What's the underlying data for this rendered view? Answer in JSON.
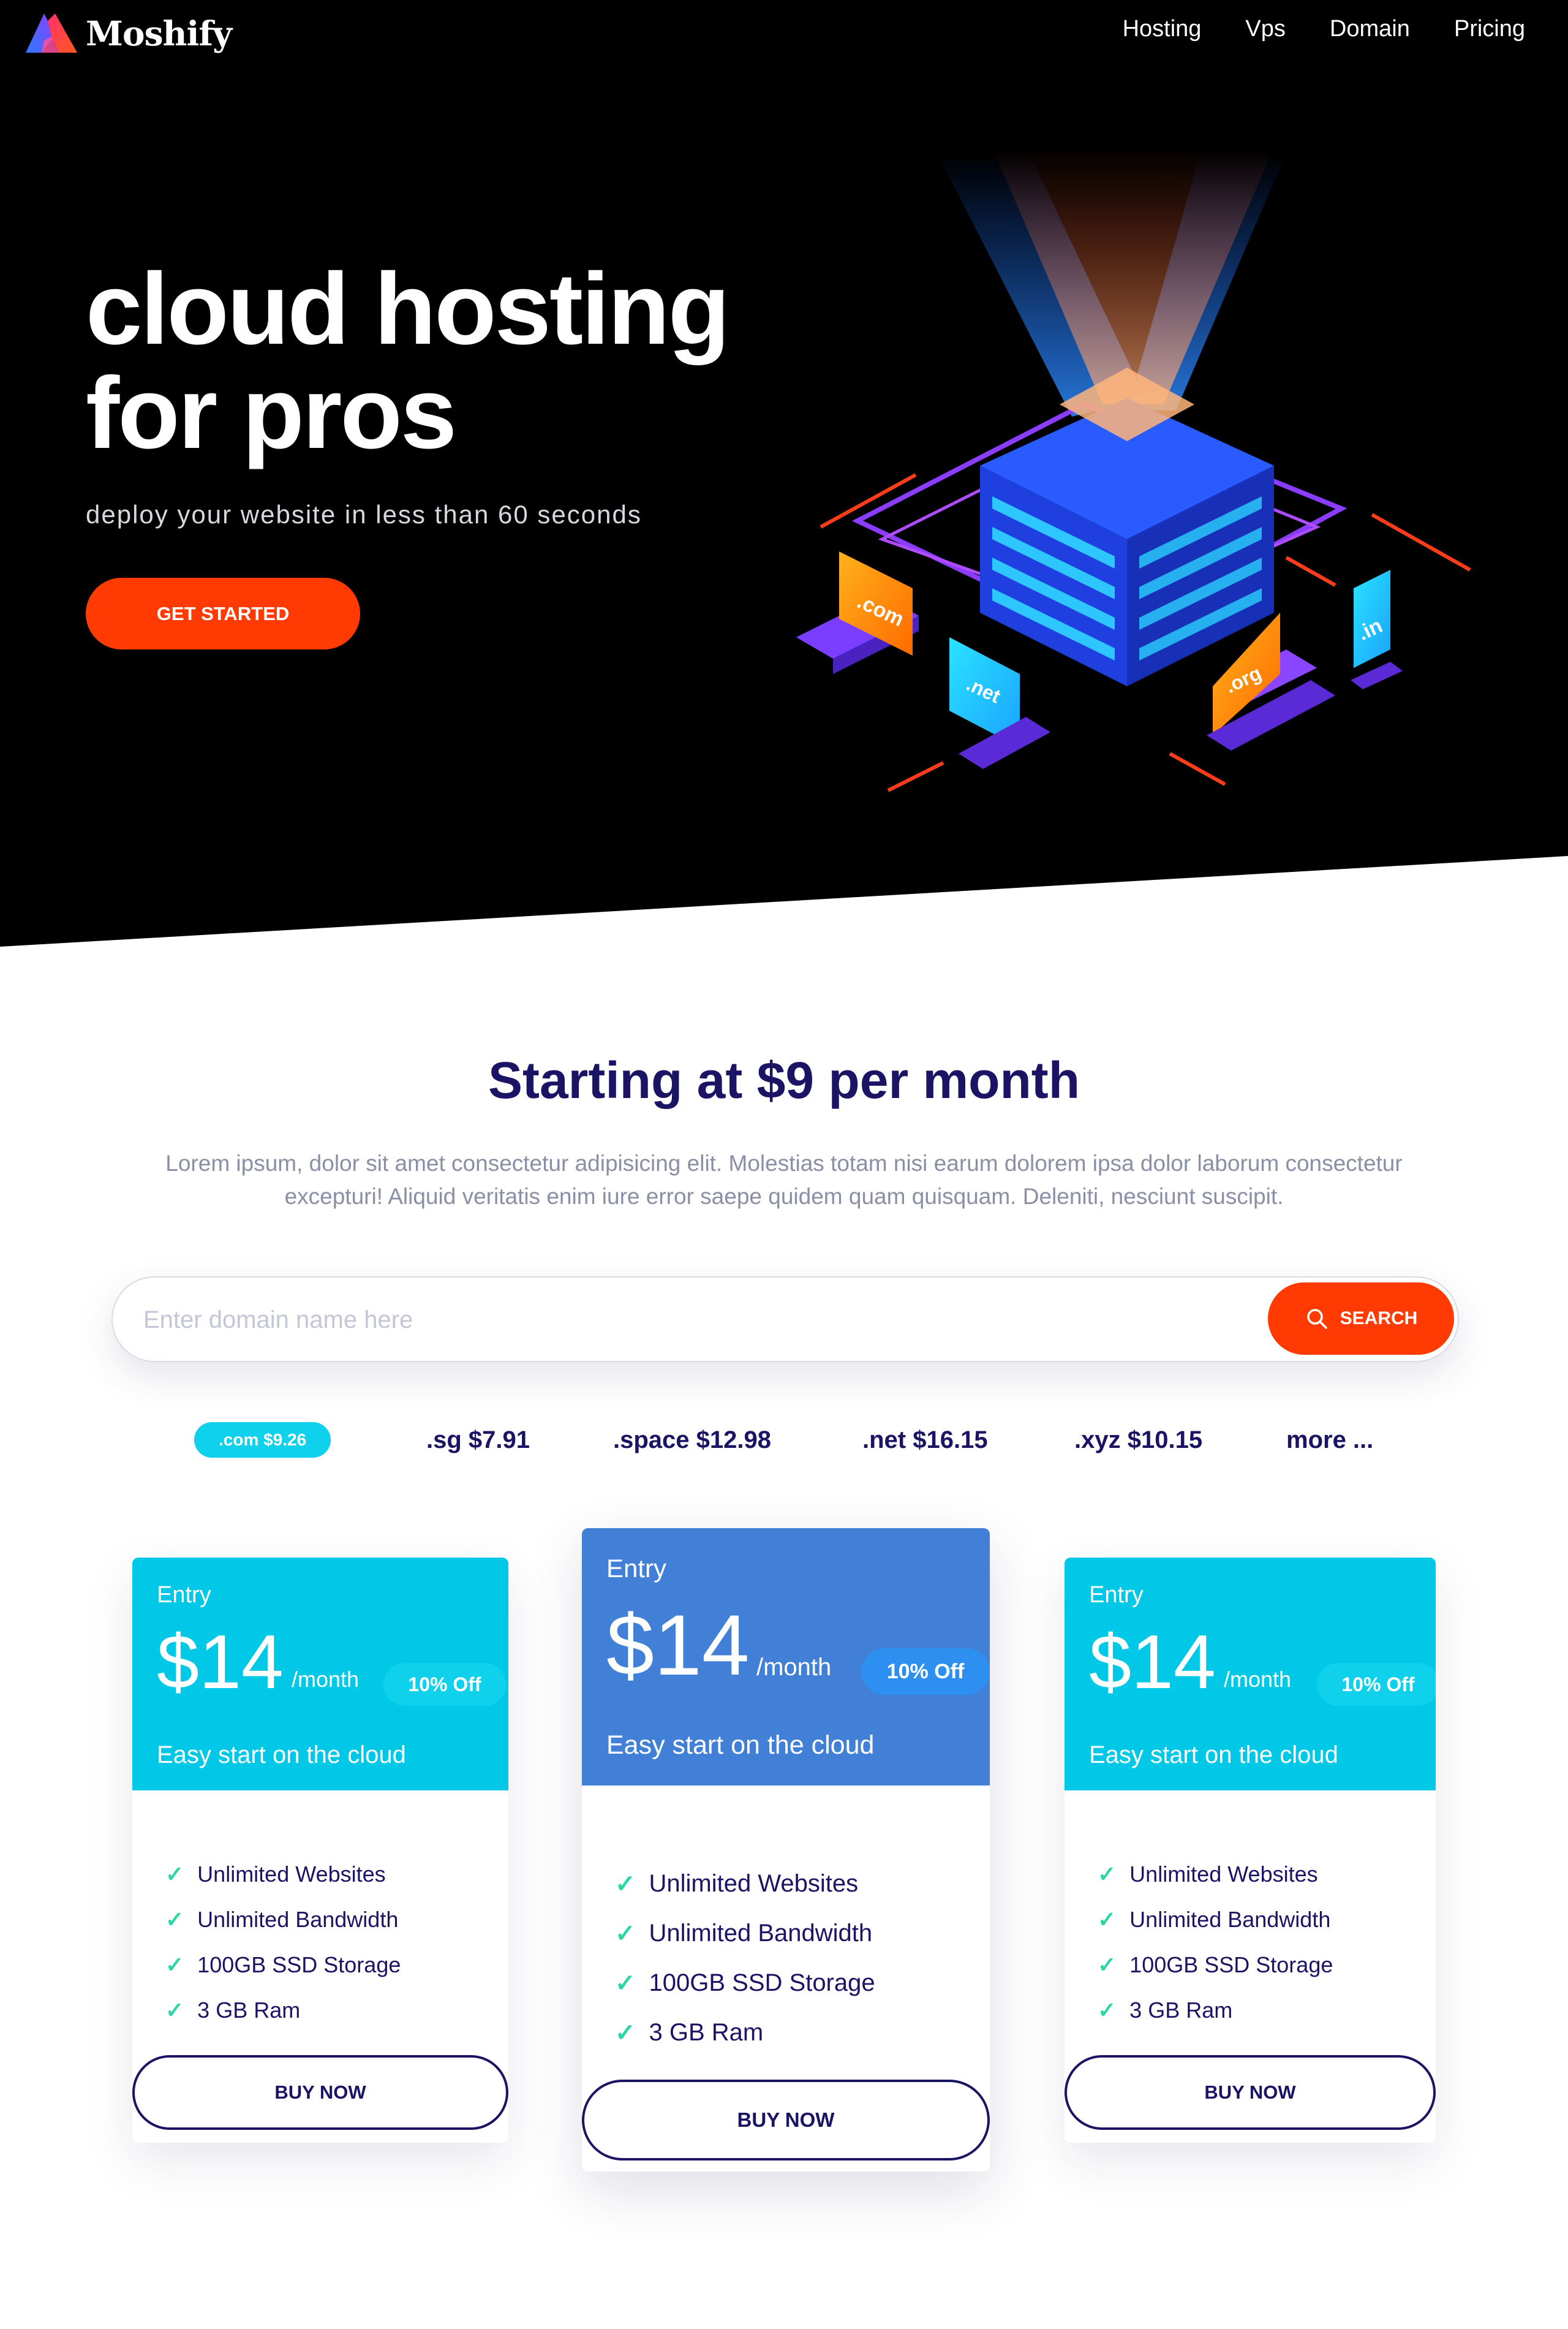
{
  "brand": {
    "name": "Moshify"
  },
  "nav": [
    "Hosting",
    "Vps",
    "Domain",
    "Pricing"
  ],
  "hero": {
    "title_line1": "cloud hosting",
    "title_line2": "for pros",
    "subtitle": "deploy your website in less than 60 seconds",
    "cta_label": "GET STARTED",
    "illustration_labels": [
      ".com",
      ".net",
      ".org",
      ".in"
    ]
  },
  "pricing_intro": {
    "title": "Starting at $9 per month",
    "description": "Lorem ipsum, dolor sit amet consectetur adipisicing elit. Molestias totam nisi earum dolorem ipsa dolor laborum consectetur excepturi! Aliquid veritatis enim iure error saepe quidem quam quisquam. Deleniti, nesciunt suscipit."
  },
  "search": {
    "placeholder": "Enter domain name here",
    "value": "",
    "button_label": "SEARCH"
  },
  "tlds": [
    {
      "label": ".com $9.26",
      "active": true
    },
    {
      "label": ".sg $7.91"
    },
    {
      "label": ".space $12.98"
    },
    {
      "label": ".net $16.15"
    },
    {
      "label": ".xyz $10.15"
    },
    {
      "label": "more ..."
    }
  ],
  "plans": [
    {
      "tier": "Entry",
      "price": "$14",
      "period": "/month",
      "discount": "10% Off",
      "tagline": "Easy start on the cloud",
      "features": [
        "Unlimited Websites",
        "Unlimited Bandwidth",
        "100GB SSD Storage",
        "3 GB Ram"
      ],
      "button": "BUY NOW"
    },
    {
      "tier": "Entry",
      "price": "$14",
      "period": "/month",
      "discount": "10% Off",
      "tagline": "Easy start on the cloud",
      "features": [
        "Unlimited Websites",
        "Unlimited Bandwidth",
        "100GB SSD Storage",
        "3 GB Ram"
      ],
      "button": "BUY NOW"
    },
    {
      "tier": "Entry",
      "price": "$14",
      "period": "/month",
      "discount": "10% Off",
      "tagline": "Easy start on the cloud",
      "features": [
        "Unlimited Websites",
        "Unlimited Bandwidth",
        "100GB SSD Storage",
        "3 GB Ram"
      ],
      "button": "BUY NOW"
    }
  ],
  "colors": {
    "accent": "#ff3a02",
    "navy": "#1b1464",
    "cyan": "#00c8e6",
    "featured_blue": "#4280d8",
    "check_green": "#2ad6a6"
  }
}
